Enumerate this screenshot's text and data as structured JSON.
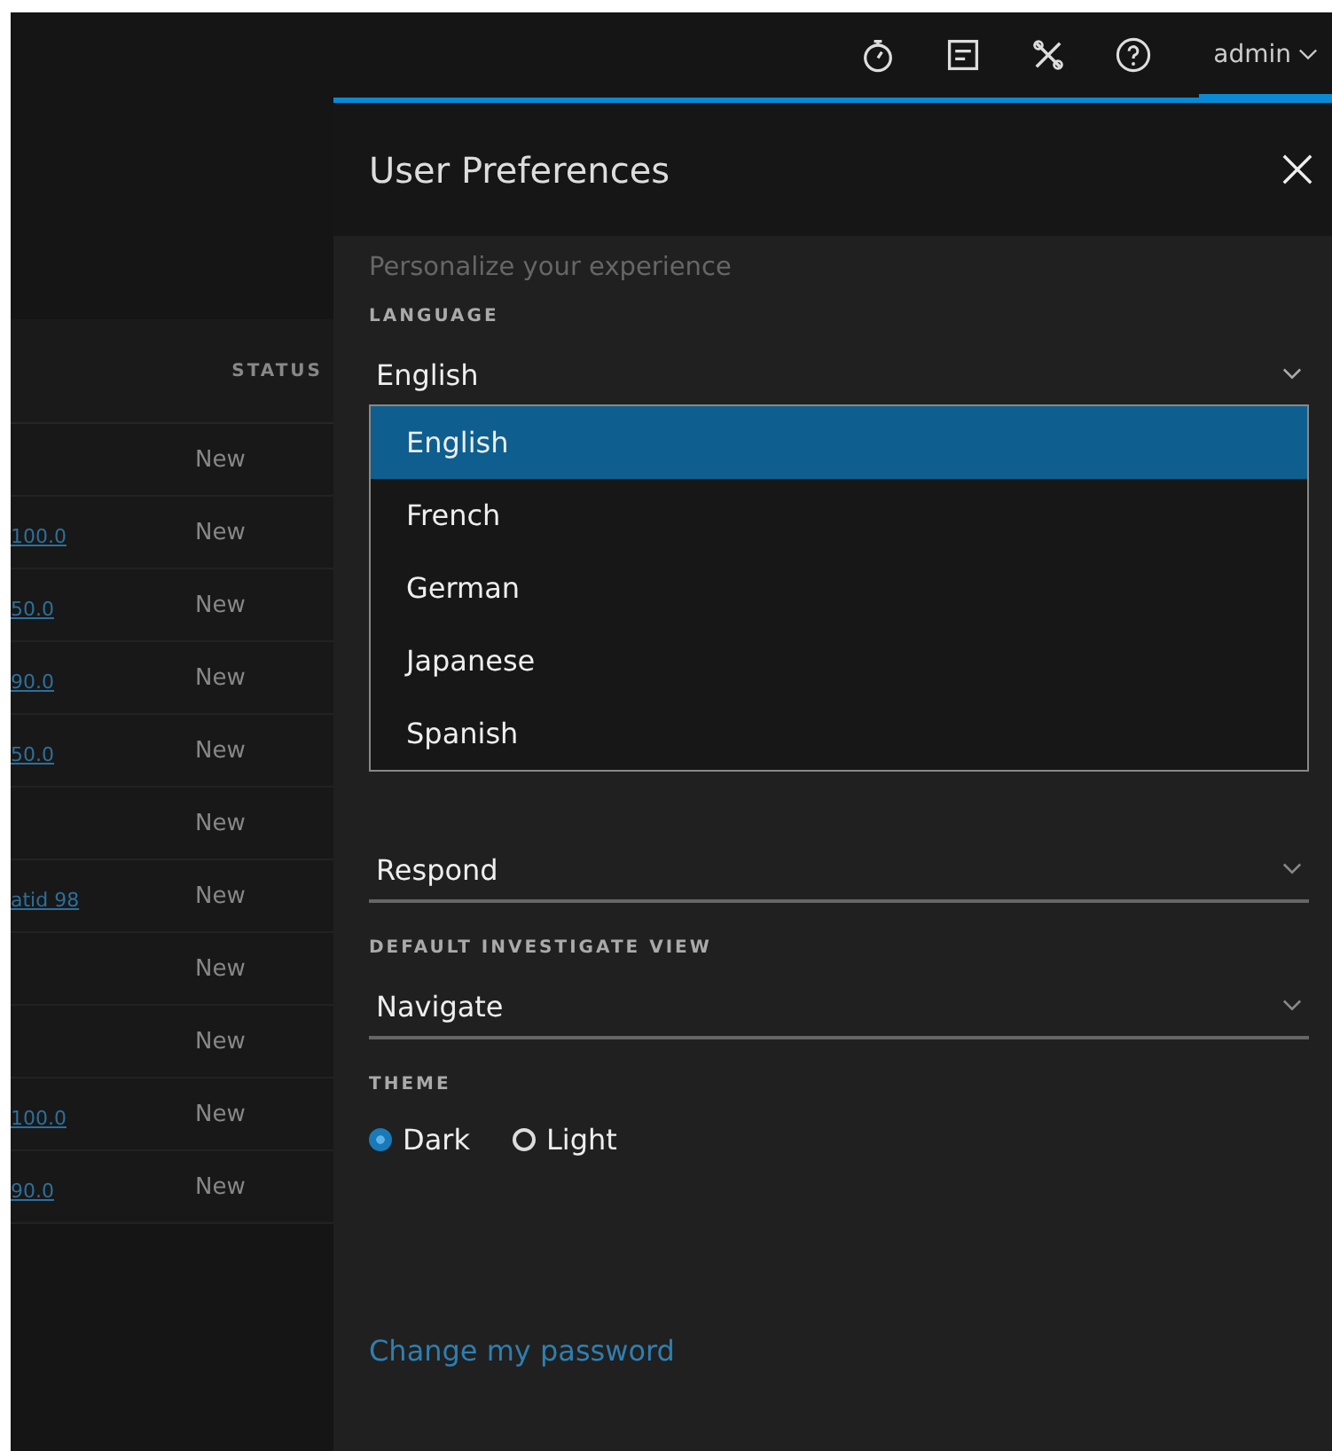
{
  "top_bar": {
    "user_menu": {
      "label": "admin",
      "selected": true
    }
  },
  "table": {
    "columns": [
      {
        "label": "STATUS"
      }
    ],
    "rows": [
      {
        "column_1": "",
        "status": "New"
      },
      {
        "column_1": "100.0",
        "status": "New"
      },
      {
        "column_1": "50.0",
        "status": "New"
      },
      {
        "column_1": "90.0",
        "status": "New"
      },
      {
        "column_1": "50.0",
        "status": "New"
      },
      {
        "column_1": "",
        "status": "New"
      },
      {
        "column_1": "atid 98",
        "status": "New"
      },
      {
        "column_1": "",
        "status": "New"
      },
      {
        "column_1": "",
        "status": "New"
      },
      {
        "column_1": "100.0",
        "status": "New"
      },
      {
        "column_1": "90.0",
        "status": "New"
      }
    ]
  },
  "panel": {
    "title": "User Preferences",
    "subtitle": "Personalize your experience",
    "language": {
      "label": "LANGUAGE",
      "value": "English",
      "expanded": true,
      "options": [
        {
          "label": "English",
          "selected": true
        },
        {
          "label": "French",
          "selected": false
        },
        {
          "label": "German",
          "selected": false
        },
        {
          "label": "Japanese",
          "selected": false
        },
        {
          "label": "Spanish",
          "selected": false
        }
      ]
    },
    "landing": {
      "value": "Respond"
    },
    "investigate": {
      "label": "DEFAULT INVESTIGATE VIEW",
      "value": "Navigate"
    },
    "theme": {
      "label": "THEME",
      "options": [
        {
          "label": "Dark",
          "selected": true
        },
        {
          "label": "Light",
          "selected": false
        }
      ]
    },
    "link": "Change my password"
  }
}
